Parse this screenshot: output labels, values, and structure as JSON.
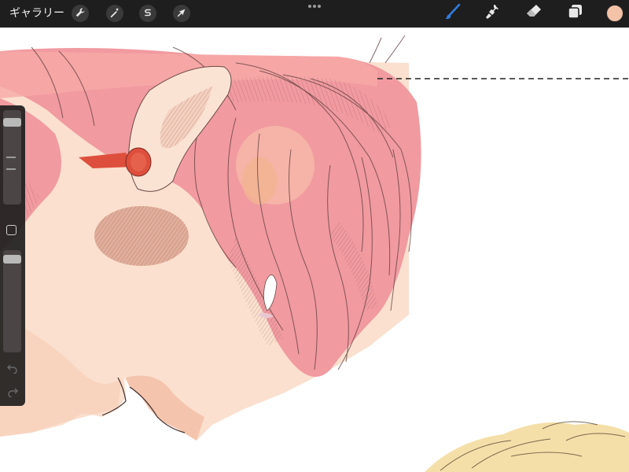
{
  "toolbar": {
    "gallery_label": "ギャラリー",
    "left_tools": [
      {
        "name": "actions",
        "icon": "wrench-icon"
      },
      {
        "name": "adjustments",
        "icon": "magic-wand-icon"
      },
      {
        "name": "selection",
        "icon": "selection-s-icon"
      },
      {
        "name": "transform",
        "icon": "arrow-cursor-icon"
      }
    ],
    "more_icon": "more-dots-icon",
    "right_tools": [
      {
        "name": "brush",
        "icon": "brush-icon",
        "active": true
      },
      {
        "name": "smudge",
        "icon": "smudge-icon"
      },
      {
        "name": "eraser",
        "icon": "eraser-icon"
      },
      {
        "name": "layers",
        "icon": "layers-icon"
      }
    ],
    "current_color": "#f4c2a6",
    "active_tool_color": "#2f7de1"
  },
  "sidebar": {
    "brush_size_level": 0.1,
    "brush_opacity_level": 0.05,
    "modify_icon": "square-modify-icon",
    "undo_icon": "undo-arrow-icon",
    "redo_icon": "redo-arrow-icon"
  },
  "palette": {
    "hair": "#f19aa0",
    "hair_light": "#f7b4ae",
    "skin": "#fbe0cf",
    "earring": "#dd4f3c",
    "blond": "#f5dfa8"
  }
}
